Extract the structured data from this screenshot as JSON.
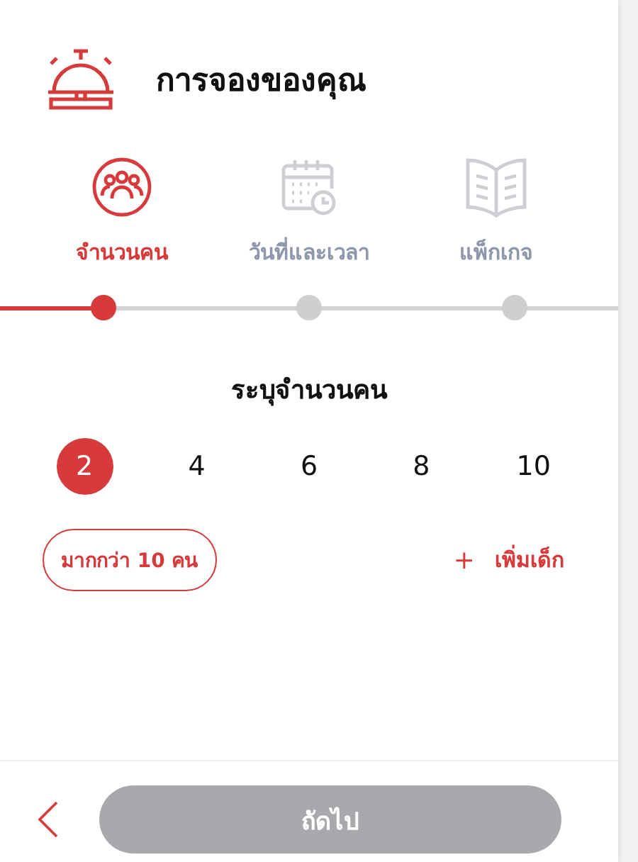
{
  "header": {
    "title": "การจองของคุณ"
  },
  "steps": [
    {
      "kind": "people",
      "label": "จำนวนคน",
      "selected": true
    },
    {
      "kind": "calendar",
      "label": "วันที่และเวลา",
      "selected": false
    },
    {
      "kind": "book",
      "label": "แพ็กเกจ",
      "selected": false
    }
  ],
  "party_size": {
    "heading": "ระบุจำนวนคน",
    "options": [
      {
        "label": "2",
        "selected": true
      },
      {
        "label": "4",
        "selected": false
      },
      {
        "label": "6",
        "selected": false
      },
      {
        "label": "8",
        "selected": false
      },
      {
        "label": "10",
        "selected": false
      }
    ],
    "more_button": "มากกว่า 10 คน",
    "add_child": {
      "icon": "+",
      "label": "เพิ่มเด็ก"
    }
  },
  "footer": {
    "next_button": {
      "label": "ถัดไป",
      "disabled": true
    }
  }
}
